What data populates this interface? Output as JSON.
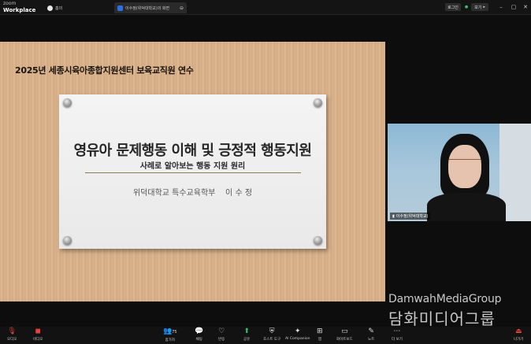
{
  "app": {
    "brand_top": "zoom",
    "brand_bottom": "Workplace"
  },
  "tabs": [
    {
      "label": "홈의"
    },
    {
      "label": "이수정(위덕대학교)의 화면"
    }
  ],
  "header": {
    "login_label": "로그인",
    "view_label": "보기"
  },
  "slide": {
    "course_title": "2025년 세종시육아종합지원센터 보육교직원 연수",
    "main_title": "영유아 문제행동 이해 및 긍정적 행동지원",
    "sub_title": "사례로 알아보는 행동 지원 원리",
    "author": "위덕대학교 특수교육학부    이 수 정"
  },
  "participant": {
    "name": "이수정(위덕대학교)"
  },
  "watermark": {
    "en": "DamwahMediaGroup",
    "ko": "담화미디어그룹"
  },
  "toolbar": {
    "audio": "오디오",
    "video": "비디오",
    "participants": "참가자",
    "participants_count": "75",
    "chat": "채팅",
    "react": "반응",
    "share": "공유",
    "host_tools": "호스트 도구",
    "ai": "AI Companion",
    "apps": "앱",
    "whiteboard": "화이트보드",
    "notes": "노트",
    "more": "더 보기",
    "leave": "나가기"
  },
  "colors": {
    "accent_red": "#e0413a",
    "share_green": "#33c16c",
    "card_divider": "#8a7a55"
  }
}
